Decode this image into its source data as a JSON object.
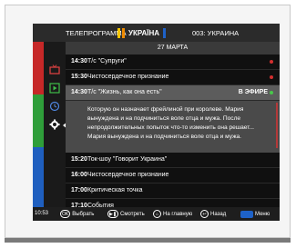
{
  "header": {
    "title": "ТЕЛЕПРОГРАММА",
    "brand": "УКРАЇНА",
    "channel": "003: УКРАИНА"
  },
  "date": "27 МАРТА",
  "sidebar": {
    "colors": [
      "#c62828",
      "#2f9e3a",
      "#1f5fbf"
    ],
    "icons": [
      "tv-icon",
      "play-icon",
      "history-icon",
      "gear-icon"
    ]
  },
  "programs": [
    {
      "time": "14:30",
      "title": "Т/с \"Супруги\"",
      "marker": "red-dot"
    },
    {
      "time": "15:30",
      "title": "Чистосердечное признание",
      "marker": "red-dot"
    },
    {
      "time": "14:30",
      "title": "Т/с \"Жизнь, как она есть\"",
      "status": "В ЭФИРЕ",
      "marker": "green-dot",
      "selected": true,
      "description": "Которую он назначает фрейлиной при королеве. Мария вынуждена и на подчиниться воле отца и мужа. После непродолжительных попыток что-то изменить она решает... Мария вынуждена и на подчиниться воле отца и мужа."
    },
    {
      "time": "15:20",
      "title": "Ток-шоу \"Говорит Украина\""
    },
    {
      "time": "16:00",
      "title": "Чистосердечное признание"
    },
    {
      "time": "17:00",
      "title": "Критическая точка"
    },
    {
      "time": "17:10",
      "title": "События"
    }
  ],
  "footer": {
    "clock": "10:53",
    "ok_key": "OK",
    "select": "Выбрать",
    "watch": "Смотреть",
    "home": "На главную",
    "back": "Назад",
    "menu": "Меню"
  }
}
